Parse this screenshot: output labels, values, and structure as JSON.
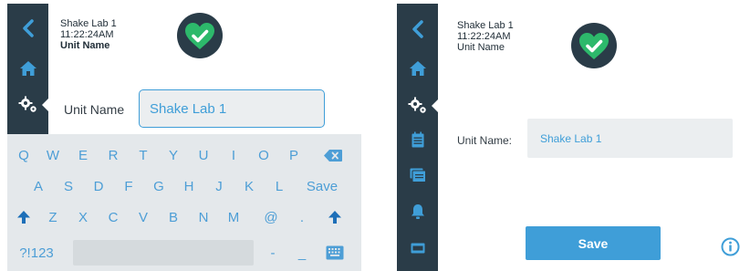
{
  "colors": {
    "sidebar": "#2a3c48",
    "accent": "#3f9ed8",
    "badge": "#2db96b"
  },
  "header": {
    "lab_name": "Shake Lab 1",
    "time": "11:22:24AM",
    "unit_label": "Unit Name"
  },
  "status": {
    "icon": "heart-check-icon"
  },
  "left_form": {
    "label": "Unit Name",
    "value": "Shake Lab 1"
  },
  "right_form": {
    "label": "Unit Name:",
    "value": "Shake Lab 1",
    "save_label": "Save"
  },
  "keyboard": {
    "row1": [
      "Q",
      "W",
      "E",
      "R",
      "T",
      "Y",
      "U",
      "I",
      "O",
      "P"
    ],
    "row2": [
      "A",
      "S",
      "D",
      "F",
      "G",
      "H",
      "J",
      "K",
      "L"
    ],
    "save_key": "Save",
    "row3": [
      "Z",
      "X",
      "C",
      "V",
      "B",
      "N",
      "M",
      "@",
      "."
    ],
    "symbols_key": "?!123",
    "dash_key": "-",
    "underscore_key": "_"
  },
  "left_nav": [
    "back-icon",
    "home-icon",
    "settings-icon"
  ],
  "right_nav": [
    "back-icon",
    "home-icon",
    "settings-icon",
    "calendar-icon",
    "folders-icon",
    "bell-icon",
    "display-icon"
  ]
}
